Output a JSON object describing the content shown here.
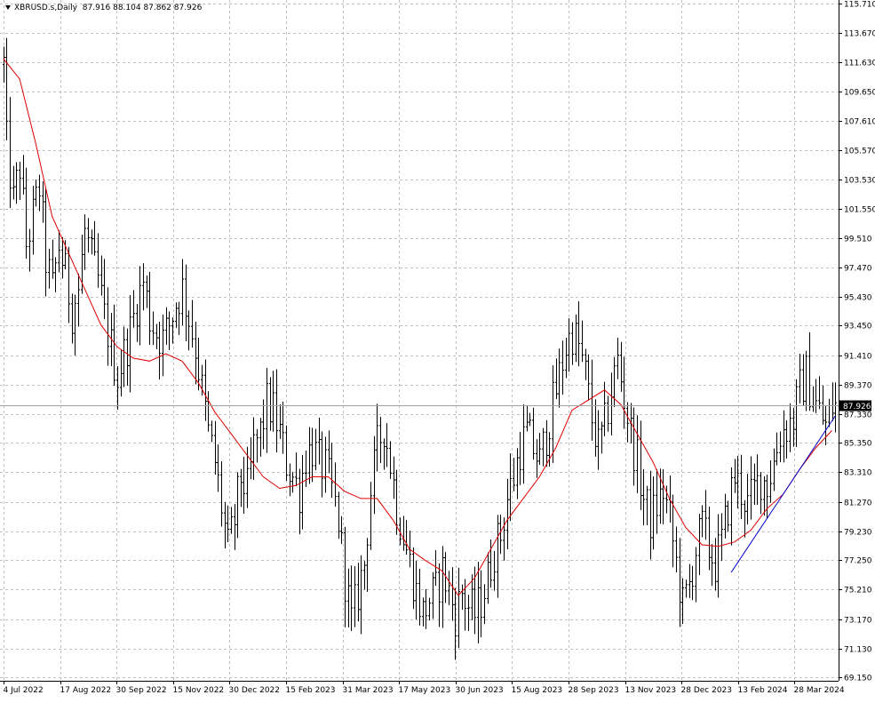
{
  "header": {
    "symbol_timeframe": "XBRUSD.s,Daily",
    "ohlc": "87.916 88.104 87.862 87.926"
  },
  "colors": {
    "background": "#ffffff",
    "grid": "#c0c0c0",
    "bars": "#000000",
    "moving_average": "#e00000",
    "trendline": "#0000cc",
    "price_label_bg": "#000000",
    "price_label_text": "#ffffff"
  },
  "chart_data": {
    "type": "ohlc-bar",
    "symbol": "XBRUSD.s",
    "timeframe": "Daily",
    "last_price": 87.926,
    "last_price_label": "87.926",
    "ylim": [
      69.15,
      115.71
    ],
    "yticks": [
      "115.710",
      "113.670",
      "111.630",
      "109.650",
      "107.610",
      "105.570",
      "103.530",
      "101.550",
      "99.510",
      "97.470",
      "95.430",
      "93.450",
      "91.410",
      "89.370",
      "87.330",
      "85.350",
      "83.310",
      "81.270",
      "79.230",
      "77.250",
      "75.210",
      "73.170",
      "71.130",
      "69.150"
    ],
    "xticks": [
      "4 Jul 2022",
      "17 Aug 2022",
      "30 Sep 2022",
      "15 Nov 2022",
      "30 Dec 2022",
      "15 Feb 2023",
      "31 Mar 2023",
      "17 May 2023",
      "30 Jun 2023",
      "15 Aug 2023",
      "28 Sep 2023",
      "13 Nov 2023",
      "28 Dec 2023",
      "13 Feb 2024",
      "28 Mar 2024"
    ],
    "grid": true,
    "price_path": [
      [
        0,
        111.5
      ],
      [
        1,
        106
      ],
      [
        3,
        102
      ],
      [
        5,
        104.5
      ],
      [
        7,
        99
      ],
      [
        9,
        101
      ],
      [
        11,
        103
      ],
      [
        13,
        98
      ],
      [
        15,
        96
      ],
      [
        17,
        99
      ],
      [
        19,
        97
      ],
      [
        21,
        94.5
      ],
      [
        23,
        96
      ],
      [
        25,
        100
      ],
      [
        27,
        98
      ],
      [
        29,
        96.5
      ],
      [
        31,
        94
      ],
      [
        33,
        92
      ],
      [
        35,
        90
      ],
      [
        37,
        91.5
      ],
      [
        39,
        93
      ],
      [
        41,
        95
      ],
      [
        43,
        96.5
      ],
      [
        45,
        94
      ],
      [
        47,
        93
      ],
      [
        49,
        92.5
      ],
      [
        51,
        93.5
      ],
      [
        53,
        95
      ],
      [
        55,
        96
      ],
      [
        57,
        94
      ],
      [
        59,
        92
      ],
      [
        61,
        89
      ],
      [
        63,
        86
      ],
      [
        65,
        84
      ],
      [
        67,
        81
      ],
      [
        69,
        78
      ],
      [
        71,
        80
      ],
      [
        73,
        83
      ],
      [
        75,
        82
      ],
      [
        77,
        85
      ],
      [
        79,
        86
      ],
      [
        81,
        88
      ],
      [
        83,
        87.5
      ],
      [
        85,
        86
      ],
      [
        87,
        84
      ],
      [
        89,
        83
      ],
      [
        91,
        82
      ],
      [
        93,
        84.5
      ],
      [
        95,
        85
      ],
      [
        97,
        84
      ],
      [
        99,
        83.5
      ],
      [
        101,
        82
      ],
      [
        103,
        80
      ],
      [
        105,
        76
      ],
      [
        107,
        73
      ],
      [
        109,
        75
      ],
      [
        111,
        77
      ],
      [
        113,
        82
      ],
      [
        115,
        85
      ],
      [
        117,
        86.5
      ],
      [
        119,
        84
      ],
      [
        121,
        81
      ],
      [
        123,
        79
      ],
      [
        125,
        77
      ],
      [
        127,
        75
      ],
      [
        129,
        73.5
      ],
      [
        131,
        74.5
      ],
      [
        133,
        75
      ],
      [
        135,
        76.5
      ],
      [
        137,
        75
      ],
      [
        139,
        73.5
      ],
      [
        141,
        75
      ],
      [
        143,
        74
      ],
      [
        145,
        73.5
      ],
      [
        147,
        74.5
      ],
      [
        149,
        76
      ],
      [
        151,
        78
      ],
      [
        153,
        79
      ],
      [
        155,
        81.5
      ],
      [
        157,
        83
      ],
      [
        159,
        85
      ],
      [
        161,
        86
      ],
      [
        163,
        85
      ],
      [
        165,
        84
      ],
      [
        167,
        86
      ],
      [
        169,
        88
      ],
      [
        171,
        90
      ],
      [
        173,
        92
      ],
      [
        175,
        93
      ],
      [
        177,
        92
      ],
      [
        179,
        90
      ],
      [
        181,
        87
      ],
      [
        183,
        85
      ],
      [
        185,
        86.5
      ],
      [
        187,
        89
      ],
      [
        189,
        91
      ],
      [
        191,
        88.5
      ],
      [
        193,
        86
      ],
      [
        195,
        84
      ],
      [
        197,
        81.5
      ],
      [
        199,
        80
      ],
      [
        201,
        81
      ],
      [
        203,
        82
      ],
      [
        205,
        80
      ],
      [
        207,
        77
      ],
      [
        209,
        74
      ],
      [
        211,
        75.5
      ],
      [
        213,
        78
      ],
      [
        215,
        79.5
      ],
      [
        217,
        78
      ],
      [
        219,
        77
      ],
      [
        221,
        78.5
      ],
      [
        223,
        81
      ],
      [
        225,
        83
      ],
      [
        227,
        82
      ],
      [
        229,
        81
      ],
      [
        231,
        82
      ],
      [
        233,
        83
      ],
      [
        235,
        82.5
      ],
      [
        237,
        84
      ],
      [
        239,
        86
      ],
      [
        241,
        86.5
      ],
      [
        243,
        87
      ],
      [
        245,
        89
      ],
      [
        247,
        90
      ],
      [
        249,
        88.5
      ],
      [
        251,
        87.5
      ],
      [
        253,
        86.5
      ],
      [
        255,
        87.9
      ]
    ],
    "moving_average": {
      "name": "",
      "points": [
        [
          0,
          111.9
        ],
        [
          5,
          110.5
        ],
        [
          10,
          106
        ],
        [
          15,
          101
        ],
        [
          20,
          98.5
        ],
        [
          25,
          96
        ],
        [
          30,
          93.5
        ],
        [
          35,
          92
        ],
        [
          40,
          91.2
        ],
        [
          45,
          91
        ],
        [
          50,
          91.5
        ],
        [
          55,
          91
        ],
        [
          60,
          89.5
        ],
        [
          65,
          87.5
        ],
        [
          70,
          86
        ],
        [
          75,
          84.5
        ],
        [
          80,
          83
        ],
        [
          85,
          82.2
        ],
        [
          90,
          82.4
        ],
        [
          95,
          83
        ],
        [
          100,
          83
        ],
        [
          105,
          82
        ],
        [
          110,
          81.5
        ],
        [
          115,
          81.5
        ],
        [
          120,
          80
        ],
        [
          125,
          78
        ],
        [
          130,
          77.2
        ],
        [
          135,
          76.5
        ],
        [
          140,
          74.8
        ],
        [
          145,
          76
        ],
        [
          150,
          78
        ],
        [
          155,
          80
        ],
        [
          160,
          81.5
        ],
        [
          165,
          83
        ],
        [
          170,
          85
        ],
        [
          175,
          87.6
        ],
        [
          180,
          88.3
        ],
        [
          185,
          89
        ],
        [
          190,
          88
        ],
        [
          195,
          86
        ],
        [
          200,
          84
        ],
        [
          205,
          81.5
        ],
        [
          210,
          79.5
        ],
        [
          215,
          78.3
        ],
        [
          220,
          78.2
        ],
        [
          225,
          78.5
        ],
        [
          230,
          79.3
        ],
        [
          235,
          80.8
        ],
        [
          240,
          81.8
        ],
        [
          245,
          83.5
        ],
        [
          250,
          85
        ],
        [
          255,
          86.2
        ]
      ]
    },
    "trendline": {
      "from": [
        224,
        76.4
      ],
      "to": [
        256,
        87.2
      ]
    }
  }
}
